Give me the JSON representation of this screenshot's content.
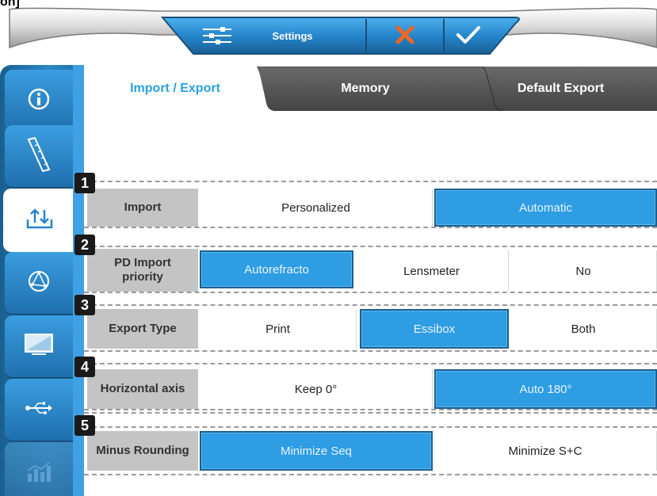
{
  "corner_label": "on]",
  "toolbar": {
    "settings_label": "Settings",
    "settings_icon": "sliders-icon",
    "cancel_icon": "close-x-icon",
    "confirm_icon": "checkmark-icon"
  },
  "sidebar": {
    "items": [
      {
        "name": "info",
        "icon": "info-icon",
        "state": "normal"
      },
      {
        "name": "ruler",
        "icon": "ruler-icon",
        "state": "normal"
      },
      {
        "name": "import-export",
        "icon": "import-export-icon",
        "state": "active"
      },
      {
        "name": "lens",
        "icon": "lens-axis-icon",
        "state": "normal"
      },
      {
        "name": "display",
        "icon": "monitor-icon",
        "state": "normal"
      },
      {
        "name": "usb",
        "icon": "usb-icon",
        "state": "normal"
      },
      {
        "name": "stats",
        "icon": "chart-icon",
        "state": "disabled"
      }
    ]
  },
  "tabs": [
    {
      "label": "Import / Export",
      "active": true
    },
    {
      "label": "Memory",
      "active": false
    },
    {
      "label": "Default Export",
      "active": false
    }
  ],
  "sections": [
    {
      "number": "1",
      "label": "Import",
      "options": [
        {
          "label": "Personalized",
          "selected": false
        },
        {
          "label": "Automatic",
          "selected": true
        }
      ]
    },
    {
      "number": "2",
      "label": "PD Import priority",
      "label_line1": "PD Import",
      "label_line2": "priority",
      "options": [
        {
          "label": "Autorefracto",
          "selected": true
        },
        {
          "label": "Lensmeter",
          "selected": false
        },
        {
          "label": "No",
          "selected": false
        }
      ]
    },
    {
      "number": "3",
      "label": "Export Type",
      "options": [
        {
          "label": "Print",
          "selected": false
        },
        {
          "label": "Essibox",
          "selected": true
        },
        {
          "label": "Both",
          "selected": false
        }
      ]
    },
    {
      "number": "4",
      "label": "Horizontal axis",
      "options": [
        {
          "label": "Keep 0°",
          "selected": false
        },
        {
          "label": "Auto 180°",
          "selected": true
        }
      ]
    },
    {
      "number": "5",
      "label": "Minus Rounding",
      "options": [
        {
          "label": "Minimize Seq",
          "selected": true
        },
        {
          "label": "Minimize S+C",
          "selected": false
        }
      ]
    }
  ],
  "colors": {
    "accent": "#2e9de3",
    "accent_dark": "#1c5e8c",
    "label_bg": "#c4c4c4",
    "tab_inactive": "#5a5a5a",
    "confirm_check": "#ffffff",
    "cancel_x": "#f26522"
  }
}
